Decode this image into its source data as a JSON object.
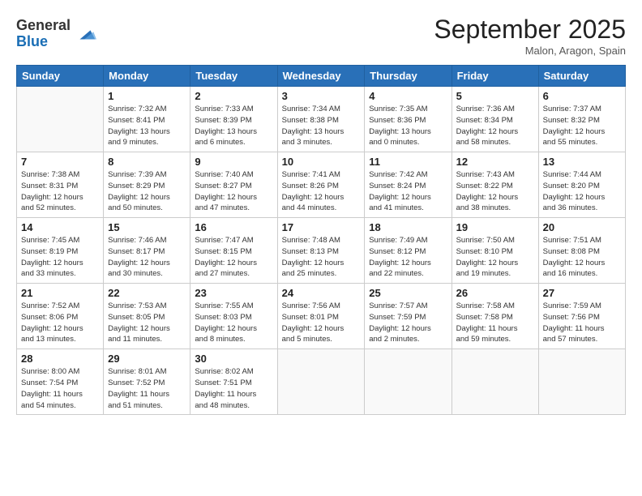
{
  "header": {
    "logo_general": "General",
    "logo_blue": "Blue",
    "month_title": "September 2025",
    "subtitle": "Malon, Aragon, Spain"
  },
  "days_of_week": [
    "Sunday",
    "Monday",
    "Tuesday",
    "Wednesday",
    "Thursday",
    "Friday",
    "Saturday"
  ],
  "weeks": [
    [
      {
        "day": "",
        "info": ""
      },
      {
        "day": "1",
        "info": "Sunrise: 7:32 AM\nSunset: 8:41 PM\nDaylight: 13 hours\nand 9 minutes."
      },
      {
        "day": "2",
        "info": "Sunrise: 7:33 AM\nSunset: 8:39 PM\nDaylight: 13 hours\nand 6 minutes."
      },
      {
        "day": "3",
        "info": "Sunrise: 7:34 AM\nSunset: 8:38 PM\nDaylight: 13 hours\nand 3 minutes."
      },
      {
        "day": "4",
        "info": "Sunrise: 7:35 AM\nSunset: 8:36 PM\nDaylight: 13 hours\nand 0 minutes."
      },
      {
        "day": "5",
        "info": "Sunrise: 7:36 AM\nSunset: 8:34 PM\nDaylight: 12 hours\nand 58 minutes."
      },
      {
        "day": "6",
        "info": "Sunrise: 7:37 AM\nSunset: 8:32 PM\nDaylight: 12 hours\nand 55 minutes."
      }
    ],
    [
      {
        "day": "7",
        "info": "Sunrise: 7:38 AM\nSunset: 8:31 PM\nDaylight: 12 hours\nand 52 minutes."
      },
      {
        "day": "8",
        "info": "Sunrise: 7:39 AM\nSunset: 8:29 PM\nDaylight: 12 hours\nand 50 minutes."
      },
      {
        "day": "9",
        "info": "Sunrise: 7:40 AM\nSunset: 8:27 PM\nDaylight: 12 hours\nand 47 minutes."
      },
      {
        "day": "10",
        "info": "Sunrise: 7:41 AM\nSunset: 8:26 PM\nDaylight: 12 hours\nand 44 minutes."
      },
      {
        "day": "11",
        "info": "Sunrise: 7:42 AM\nSunset: 8:24 PM\nDaylight: 12 hours\nand 41 minutes."
      },
      {
        "day": "12",
        "info": "Sunrise: 7:43 AM\nSunset: 8:22 PM\nDaylight: 12 hours\nand 38 minutes."
      },
      {
        "day": "13",
        "info": "Sunrise: 7:44 AM\nSunset: 8:20 PM\nDaylight: 12 hours\nand 36 minutes."
      }
    ],
    [
      {
        "day": "14",
        "info": "Sunrise: 7:45 AM\nSunset: 8:19 PM\nDaylight: 12 hours\nand 33 minutes."
      },
      {
        "day": "15",
        "info": "Sunrise: 7:46 AM\nSunset: 8:17 PM\nDaylight: 12 hours\nand 30 minutes."
      },
      {
        "day": "16",
        "info": "Sunrise: 7:47 AM\nSunset: 8:15 PM\nDaylight: 12 hours\nand 27 minutes."
      },
      {
        "day": "17",
        "info": "Sunrise: 7:48 AM\nSunset: 8:13 PM\nDaylight: 12 hours\nand 25 minutes."
      },
      {
        "day": "18",
        "info": "Sunrise: 7:49 AM\nSunset: 8:12 PM\nDaylight: 12 hours\nand 22 minutes."
      },
      {
        "day": "19",
        "info": "Sunrise: 7:50 AM\nSunset: 8:10 PM\nDaylight: 12 hours\nand 19 minutes."
      },
      {
        "day": "20",
        "info": "Sunrise: 7:51 AM\nSunset: 8:08 PM\nDaylight: 12 hours\nand 16 minutes."
      }
    ],
    [
      {
        "day": "21",
        "info": "Sunrise: 7:52 AM\nSunset: 8:06 PM\nDaylight: 12 hours\nand 13 minutes."
      },
      {
        "day": "22",
        "info": "Sunrise: 7:53 AM\nSunset: 8:05 PM\nDaylight: 12 hours\nand 11 minutes."
      },
      {
        "day": "23",
        "info": "Sunrise: 7:55 AM\nSunset: 8:03 PM\nDaylight: 12 hours\nand 8 minutes."
      },
      {
        "day": "24",
        "info": "Sunrise: 7:56 AM\nSunset: 8:01 PM\nDaylight: 12 hours\nand 5 minutes."
      },
      {
        "day": "25",
        "info": "Sunrise: 7:57 AM\nSunset: 7:59 PM\nDaylight: 12 hours\nand 2 minutes."
      },
      {
        "day": "26",
        "info": "Sunrise: 7:58 AM\nSunset: 7:58 PM\nDaylight: 11 hours\nand 59 minutes."
      },
      {
        "day": "27",
        "info": "Sunrise: 7:59 AM\nSunset: 7:56 PM\nDaylight: 11 hours\nand 57 minutes."
      }
    ],
    [
      {
        "day": "28",
        "info": "Sunrise: 8:00 AM\nSunset: 7:54 PM\nDaylight: 11 hours\nand 54 minutes."
      },
      {
        "day": "29",
        "info": "Sunrise: 8:01 AM\nSunset: 7:52 PM\nDaylight: 11 hours\nand 51 minutes."
      },
      {
        "day": "30",
        "info": "Sunrise: 8:02 AM\nSunset: 7:51 PM\nDaylight: 11 hours\nand 48 minutes."
      },
      {
        "day": "",
        "info": ""
      },
      {
        "day": "",
        "info": ""
      },
      {
        "day": "",
        "info": ""
      },
      {
        "day": "",
        "info": ""
      }
    ]
  ]
}
